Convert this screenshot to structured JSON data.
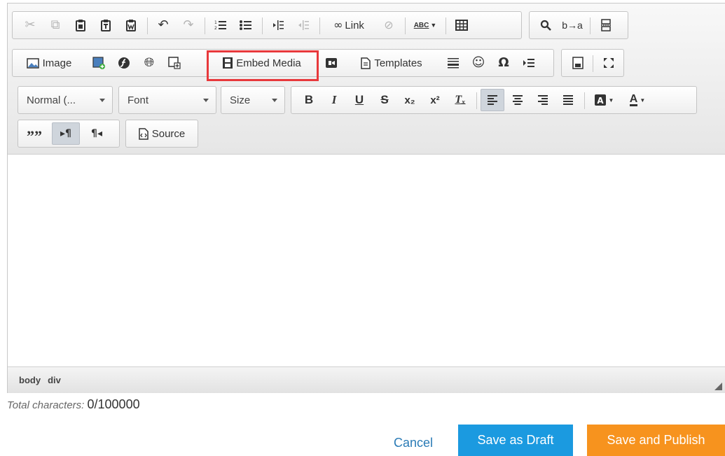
{
  "toolbar": {
    "row1": {
      "cut": "cut-icon",
      "copy": "copy-icon",
      "paste": "paste-icon",
      "paste_text": "paste-text-icon",
      "paste_word": "paste-from-word-icon",
      "undo": "undo-icon",
      "redo": "redo-icon",
      "numbered_list": "numbered-list-icon",
      "bulleted_list": "bulleted-list-icon",
      "decrease_indent": "decrease-indent-icon",
      "increase_indent": "increase-indent-icon",
      "link_label": "Link",
      "unlink": "unlink-icon",
      "spellcheck_label": "ABC",
      "table": "table-icon",
      "find": "find-icon",
      "replace_label": "b→a",
      "page_break": "page-break-icon"
    },
    "row2": {
      "image_label": "Image",
      "embed_media_label": "Embed Media",
      "templates_label": "Templates"
    },
    "row3": {
      "format_label": "Normal (...",
      "font_label": "Font",
      "size_label": "Size",
      "bold": "B",
      "italic": "I",
      "underline": "U",
      "strike": "S",
      "subscript": "x₂",
      "superscript": "x²",
      "remove_format": "Tₓ",
      "text_color_label": "A"
    },
    "row4": {
      "blockquote": "””",
      "source_label": "Source"
    }
  },
  "statusbar": {
    "path": [
      "body",
      "div"
    ]
  },
  "footer": {
    "char_label": "Total characters:",
    "char_value": "0/100000",
    "cancel_label": "Cancel",
    "draft_label": "Save as Draft",
    "publish_label": "Save and Publish"
  },
  "colors": {
    "highlight": "#e8393c",
    "draft": "#1b9ae0",
    "publish": "#f7931e",
    "link": "#2a7bb6"
  }
}
